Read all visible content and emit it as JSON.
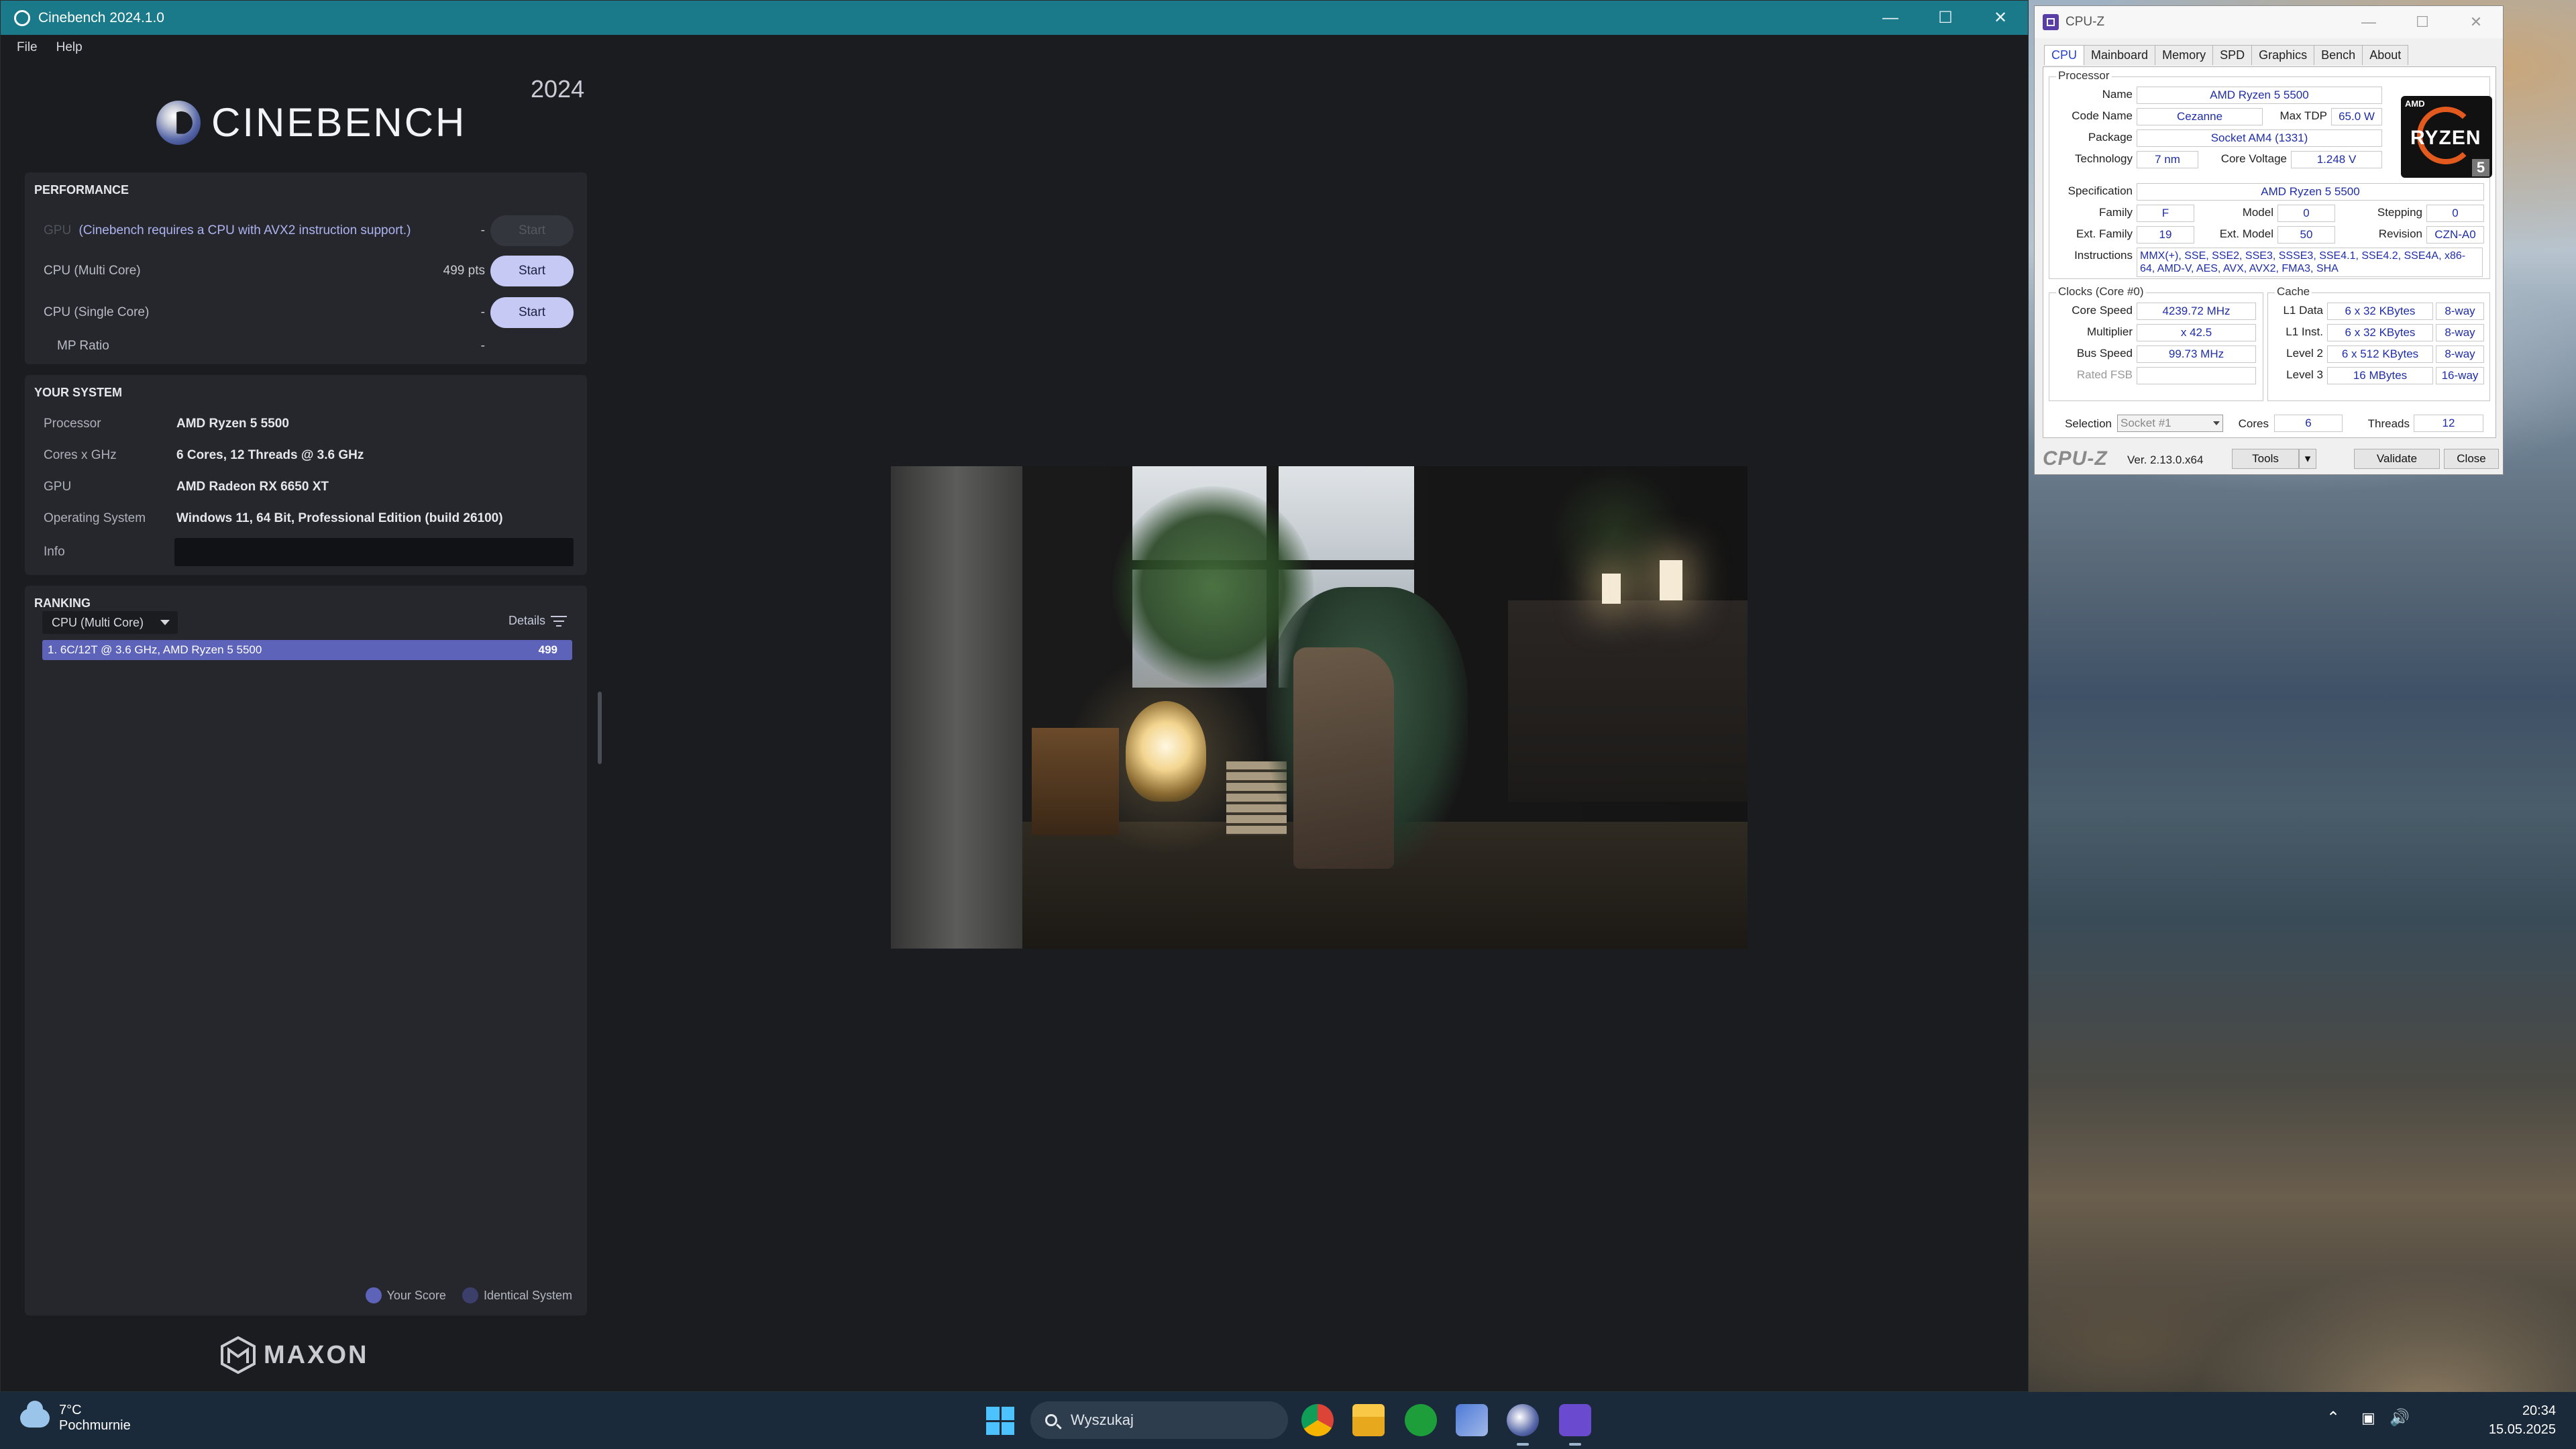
{
  "cinebench": {
    "window_title": "Cinebench 2024.1.0",
    "menu": [
      "File",
      "Help"
    ],
    "logo_text": "CINEBENCH",
    "year": "2024",
    "performance": {
      "title": "PERFORMANCE",
      "gpu_label": "GPU",
      "gpu_note": "(Cinebench requires a CPU with AVX2 instruction support.)",
      "gpu_value": "-",
      "multi_label": "CPU (Multi Core)",
      "multi_value": "499 pts",
      "single_label": "CPU (Single Core)",
      "single_value": "-",
      "mp_label": "MP Ratio",
      "mp_value": "-",
      "start_label": "Start"
    },
    "system": {
      "title": "YOUR SYSTEM",
      "rows": [
        {
          "label": "Processor",
          "value": "AMD Ryzen 5 5500"
        },
        {
          "label": "Cores x GHz",
          "value": "6 Cores, 12 Threads @ 3.6 GHz"
        },
        {
          "label": "GPU",
          "value": "AMD Radeon RX 6650 XT"
        },
        {
          "label": "Operating System",
          "value": "Windows 11, 64 Bit, Professional Edition (build 26100)"
        },
        {
          "label": "Info",
          "value": ""
        }
      ]
    },
    "ranking": {
      "title": "RANKING",
      "dropdown": "CPU (Multi Core)",
      "details": "Details",
      "entry": "1. 6C/12T @ 3.6 GHz, AMD Ryzen 5 5500",
      "entry_score": "499",
      "legend_your": "Your Score",
      "legend_identical": "Identical System",
      "your_color": "#5d63b8",
      "identical_color": "#3c3f6a"
    },
    "brand": "MAXON"
  },
  "cpuz": {
    "window_title": "CPU-Z",
    "tabs": [
      "CPU",
      "Mainboard",
      "Memory",
      "SPD",
      "Graphics",
      "Bench",
      "About"
    ],
    "processor": {
      "group": "Processor",
      "name_label": "Name",
      "name": "AMD Ryzen 5 5500",
      "code_label": "Code Name",
      "code": "Cezanne",
      "tdp_label": "Max TDP",
      "tdp": "65.0 W",
      "package_label": "Package",
      "package": "Socket AM4 (1331)",
      "tech_label": "Technology",
      "tech": "7 nm",
      "voltage_label": "Core Voltage",
      "voltage": "1.248 V",
      "spec_label": "Specification",
      "spec": "AMD Ryzen 5 5500",
      "family_label": "Family",
      "family": "F",
      "model_label": "Model",
      "model": "0",
      "stepping_label": "Stepping",
      "stepping": "0",
      "extfamily_label": "Ext. Family",
      "extfamily": "19",
      "extmodel_label": "Ext. Model",
      "extmodel": "50",
      "revision_label": "Revision",
      "revision": "CZN-A0",
      "instr_label": "Instructions",
      "instr": "MMX(+), SSE, SSE2, SSE3, SSSE3, SSE4.1, SSE4.2, SSE4A, x86-64, AMD-V, AES, AVX, AVX2, FMA3, SHA",
      "logo_amd": "AMD",
      "logo_word": "RYZEN",
      "logo_num": "5"
    },
    "clocks": {
      "group": "Clocks (Core #0)",
      "speed_label": "Core Speed",
      "speed": "4239.72 MHz",
      "mult_label": "Multiplier",
      "mult": "x 42.5",
      "bus_label": "Bus Speed",
      "bus": "99.73 MHz",
      "fsb_label": "Rated FSB",
      "fsb": ""
    },
    "cache": {
      "group": "Cache",
      "l1d_label": "L1 Data",
      "l1d": "6 x 32 KBytes",
      "l1d_way": "8-way",
      "l1i_label": "L1 Inst.",
      "l1i": "6 x 32 KBytes",
      "l1i_way": "8-way",
      "l2_label": "Level 2",
      "l2": "6 x 512 KBytes",
      "l2_way": "8-way",
      "l3_label": "Level 3",
      "l3": "16 MBytes",
      "l3_way": "16-way"
    },
    "selection_label": "Selection",
    "selection": "Socket #1",
    "cores_label": "Cores",
    "cores": "6",
    "threads_label": "Threads",
    "threads": "12",
    "brand": "CPU-Z",
    "version": "Ver. 2.13.0.x64",
    "tools": "Tools",
    "validate": "Validate",
    "close": "Close"
  },
  "taskbar": {
    "temp": "7°C",
    "weather": "Pochmurnie",
    "search_placeholder": "Wyszukaj",
    "time": "20:34",
    "date": "15.05.2025"
  }
}
